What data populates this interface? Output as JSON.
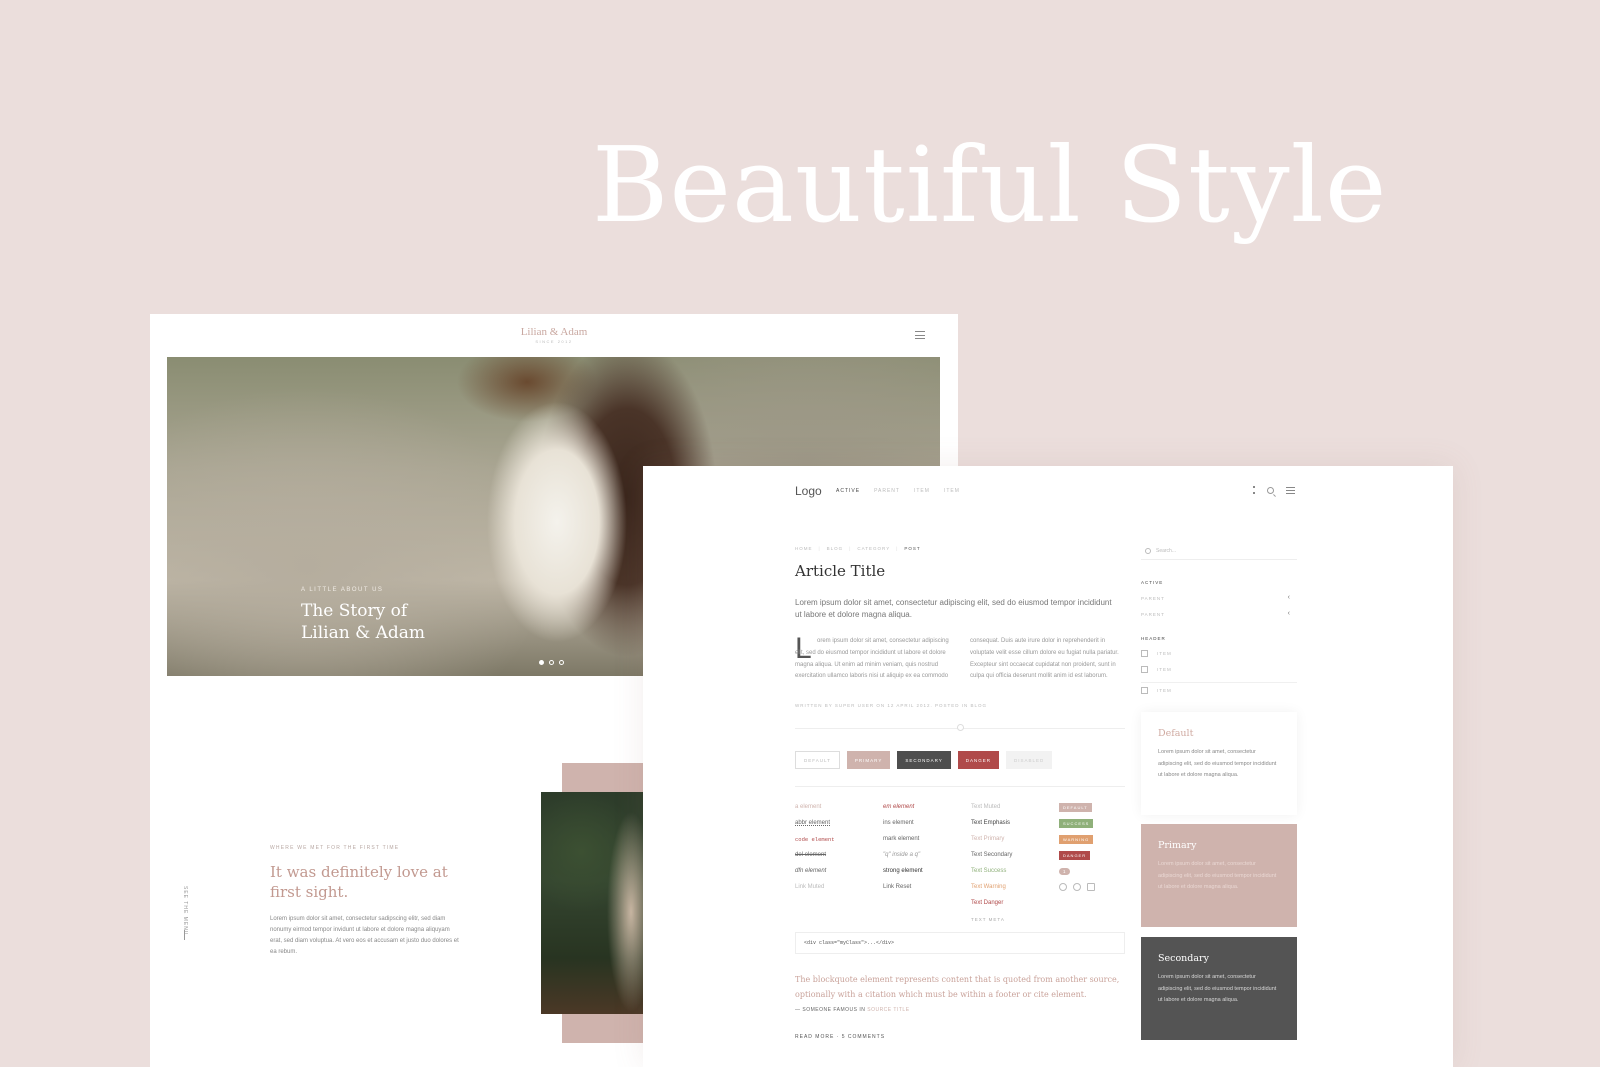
{
  "headline": "Beautiful Style",
  "back": {
    "brand": "Lilian & Adam",
    "brand_sub": "SINCE 2012",
    "hero_kicker": "A LITTLE ABOUT US",
    "hero_title_1": "The Story of",
    "hero_title_2": "Lilian & Adam",
    "story_label": "WHERE WE MET FOR THE FIRST TIME",
    "story_title": "It was definitely love at first sight.",
    "story_text": "Lorem ipsum dolor sit amet, consectetur sadipscing elitr, sed diam nonumy eirmod tempor invidunt ut labore et dolore magna aliquyam erat, sed diam voluptua. At vero eos et accusam et justo duo dolores et ea rebum.",
    "side_text": "SEE THE MENU"
  },
  "front": {
    "logo": "Logo",
    "nav": [
      "ACTIVE",
      "PARENT",
      "ITEM",
      "ITEM"
    ],
    "breadcrumb": [
      "HOME",
      "BLOG",
      "CATEGORY",
      "POST"
    ],
    "article_title": "Article Title",
    "lead": "Lorem ipsum dolor sit amet, consectetur adipiscing elit, sed do eiusmod tempor incididunt ut labore et dolore magna aliqua.",
    "dropcap": "L",
    "col1": "orem ipsum dolor sit amet, consectetur adipiscing elit, sed do eiusmod tempor incididunt ut labore et dolore magna aliqua. Ut enim ad minim veniam, quis nostrud exercitation ullamco laboris nisi ut aliquip ex ea commodo",
    "col2": "consequat. Duis aute irure dolor in reprehenderit in voluptate velit esse cillum dolore eu fugiat nulla pariatur. Excepteur sint occaecat cupidatat non proident, sunt in culpa qui officia deserunt mollit anim id est laborum.",
    "meta": "WRITTEN BY SUPER USER ON 12 APRIL 2012. POSTED IN BLOG",
    "buttons": [
      "DEFAULT",
      "PRIMARY",
      "SECONDARY",
      "DANGER",
      "DISABLED"
    ],
    "style_col1": [
      "a element",
      "abbr element",
      "code element",
      "del element",
      "dfn element",
      "Link Muted"
    ],
    "style_col2": [
      "em element",
      "ins element",
      "mark element",
      "\"q\" inside a q\"",
      "strong element",
      "Link Reset"
    ],
    "style_col3": [
      "Text Muted",
      "Text Emphasis",
      "Text Primary",
      "Text Secondary",
      "Text Success",
      "Text Warning",
      "Text Danger",
      "TEXT META"
    ],
    "labels": [
      "DEFAULT",
      "SUCCESS",
      "WARNING",
      "DANGER"
    ],
    "badge": "1",
    "code": "<div class=\"myClass\">...</div>",
    "blockquote": "The blockquote element represents content that is quoted from another source, optionally with a citation which must be within a footer or cite element.",
    "cite_prefix": "— SOMEONE FAMOUS IN",
    "cite_source": "SOURCE TITLE",
    "readmore": "READ MORE · 5 COMMENTS",
    "sidebar": {
      "search_placeholder": "Search...",
      "active": "ACTIVE",
      "parent1": "PARENT",
      "parent2": "PARENT",
      "header": "HEADER",
      "item1": "ITEM",
      "item2": "ITEM",
      "item3": "ITEM"
    },
    "cards": {
      "default_title": "Default",
      "primary_title": "Primary",
      "secondary_title": "Secondary",
      "body": "Lorem ipsum dolor sit amet, consectetur adipiscing elit, sed do eiusmod tempor incididunt ut labore et dolore magna aliqua."
    }
  },
  "colors": {
    "background": "#ebdedc",
    "primary": "#cfb3ad",
    "secondary": "#4e4e4e",
    "danger": "#b04a4a",
    "success": "#8fb07a",
    "warning": "#e0a070"
  }
}
